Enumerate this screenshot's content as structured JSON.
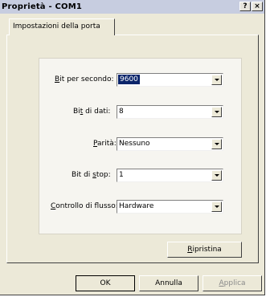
{
  "window": {
    "title": "Proprietà - COM1",
    "help_glyph": "?",
    "close_glyph": "×"
  },
  "tabs": [
    {
      "label": "Impostazioni della porta"
    }
  ],
  "settings": [
    {
      "label_pre": "",
      "label_u": "B",
      "label_post": "it per secondo:",
      "value": "9600",
      "selected": true
    },
    {
      "label_pre": "Bi",
      "label_u": "t",
      "label_post": " di dati:",
      "value": "8"
    },
    {
      "label_pre": "",
      "label_u": "P",
      "label_post": "arità:",
      "value": "Nessuno"
    },
    {
      "label_pre": "Bit di ",
      "label_u": "s",
      "label_post": "top:",
      "value": "1"
    },
    {
      "label_pre": "",
      "label_u": "C",
      "label_post": "ontrollo di flusso:",
      "value": "Hardware"
    }
  ],
  "restore_button": {
    "u": "R",
    "rest": "ipristina"
  },
  "footer": {
    "ok": "OK",
    "cancel": "Annulla",
    "apply_u": "A",
    "apply_rest": "pplica"
  },
  "colors": {
    "title_bar": "#c7cde0",
    "dialog_bg": "#ece9d8",
    "selection": "#0a246a"
  }
}
